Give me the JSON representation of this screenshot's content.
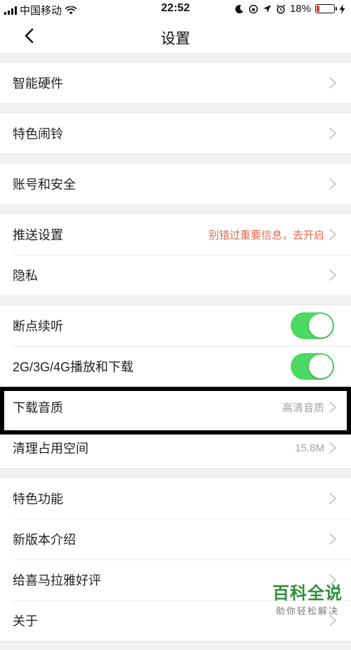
{
  "status_bar": {
    "carrier": "中国移动",
    "time": "22:52",
    "battery_percent": "18%",
    "battery_level": 0.18
  },
  "nav": {
    "title": "设置"
  },
  "groups": [
    {
      "rows": [
        {
          "label": "智能硬件"
        }
      ]
    },
    {
      "rows": [
        {
          "label": "特色闹铃"
        }
      ]
    },
    {
      "rows": [
        {
          "label": "账号和安全"
        }
      ]
    },
    {
      "rows": [
        {
          "label": "推送设置",
          "value": "别错过重要信息，去开启"
        },
        {
          "label": "隐私"
        }
      ]
    },
    {
      "rows": [
        {
          "label": "断点续听",
          "toggle": true
        },
        {
          "label": "2G/3G/4G播放和下载",
          "toggle": true
        },
        {
          "label": "下载音质",
          "value": "高清音质"
        },
        {
          "label": "清理占用空间",
          "value": "15.8M"
        }
      ]
    },
    {
      "rows": [
        {
          "label": "特色功能"
        },
        {
          "label": "新版本介绍"
        },
        {
          "label": "给喜马拉雅好评"
        },
        {
          "label": "关于"
        }
      ]
    }
  ],
  "watermark": {
    "big": "百科全说",
    "small": "助你轻松解决"
  },
  "colors": {
    "toggle_on": "#4cd964",
    "alert_text": "#e8654a",
    "battery_low": "#e8352e"
  }
}
